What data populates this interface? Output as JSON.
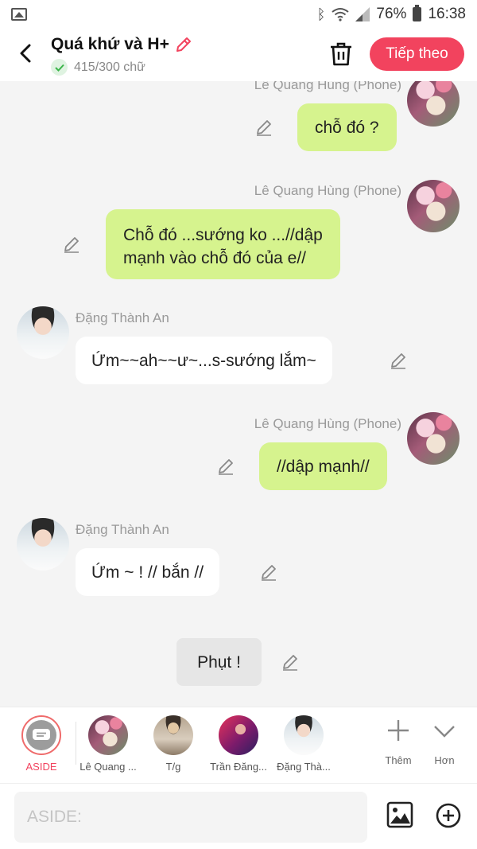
{
  "status_bar": {
    "battery": "76%",
    "time": "16:38"
  },
  "header": {
    "title": "Quá khứ và H+",
    "word_count": "415/300 chữ",
    "next_label": "Tiếp theo"
  },
  "messages": [
    {
      "sender": "Lê Quang Hùng (Phone)",
      "text": "chỗ đó ?"
    },
    {
      "sender": "Lê Quang Hùng (Phone)",
      "text_lines": [
        "Chỗ đó ...sướng ko ...//dập",
        "mạnh vào chỗ đó của e//"
      ]
    },
    {
      "sender": "Đặng Thành An",
      "text": "Ứm~~ah~~ư~...s-sướng lắm~"
    },
    {
      "sender": "Lê Quang Hùng (Phone)",
      "text": "//dập mạnh//"
    },
    {
      "sender": "Đặng Thành An",
      "text": "Ứm ~ ! // bắn //"
    },
    {
      "narration": "Phụt !"
    }
  ],
  "characters": [
    {
      "label": "ASIDE"
    },
    {
      "label": "Lê Quang ..."
    },
    {
      "label": "T/g"
    },
    {
      "label": "Trần Đăng..."
    },
    {
      "label": "Đặng Thà..."
    }
  ],
  "tools": {
    "add_label": "Thêm",
    "more_label": "Hơn"
  },
  "input": {
    "placeholder": "ASIDE:"
  },
  "colors": {
    "accent": "#f2435e",
    "green_bubble": "#d6f38e",
    "white_bubble": "#ffffff",
    "narration_bubble": "#e6e6e6",
    "check": "#3bb54a"
  },
  "icons": [
    "gallery-icon",
    "bluetooth-icon",
    "wifi-icon",
    "signal-icon",
    "battery-icon",
    "back-icon",
    "edit-pencil-icon",
    "check-icon",
    "trash-icon",
    "chat-bubble-icon",
    "plus-icon",
    "chevron-down-icon",
    "image-icon",
    "plus-circle-icon"
  ]
}
